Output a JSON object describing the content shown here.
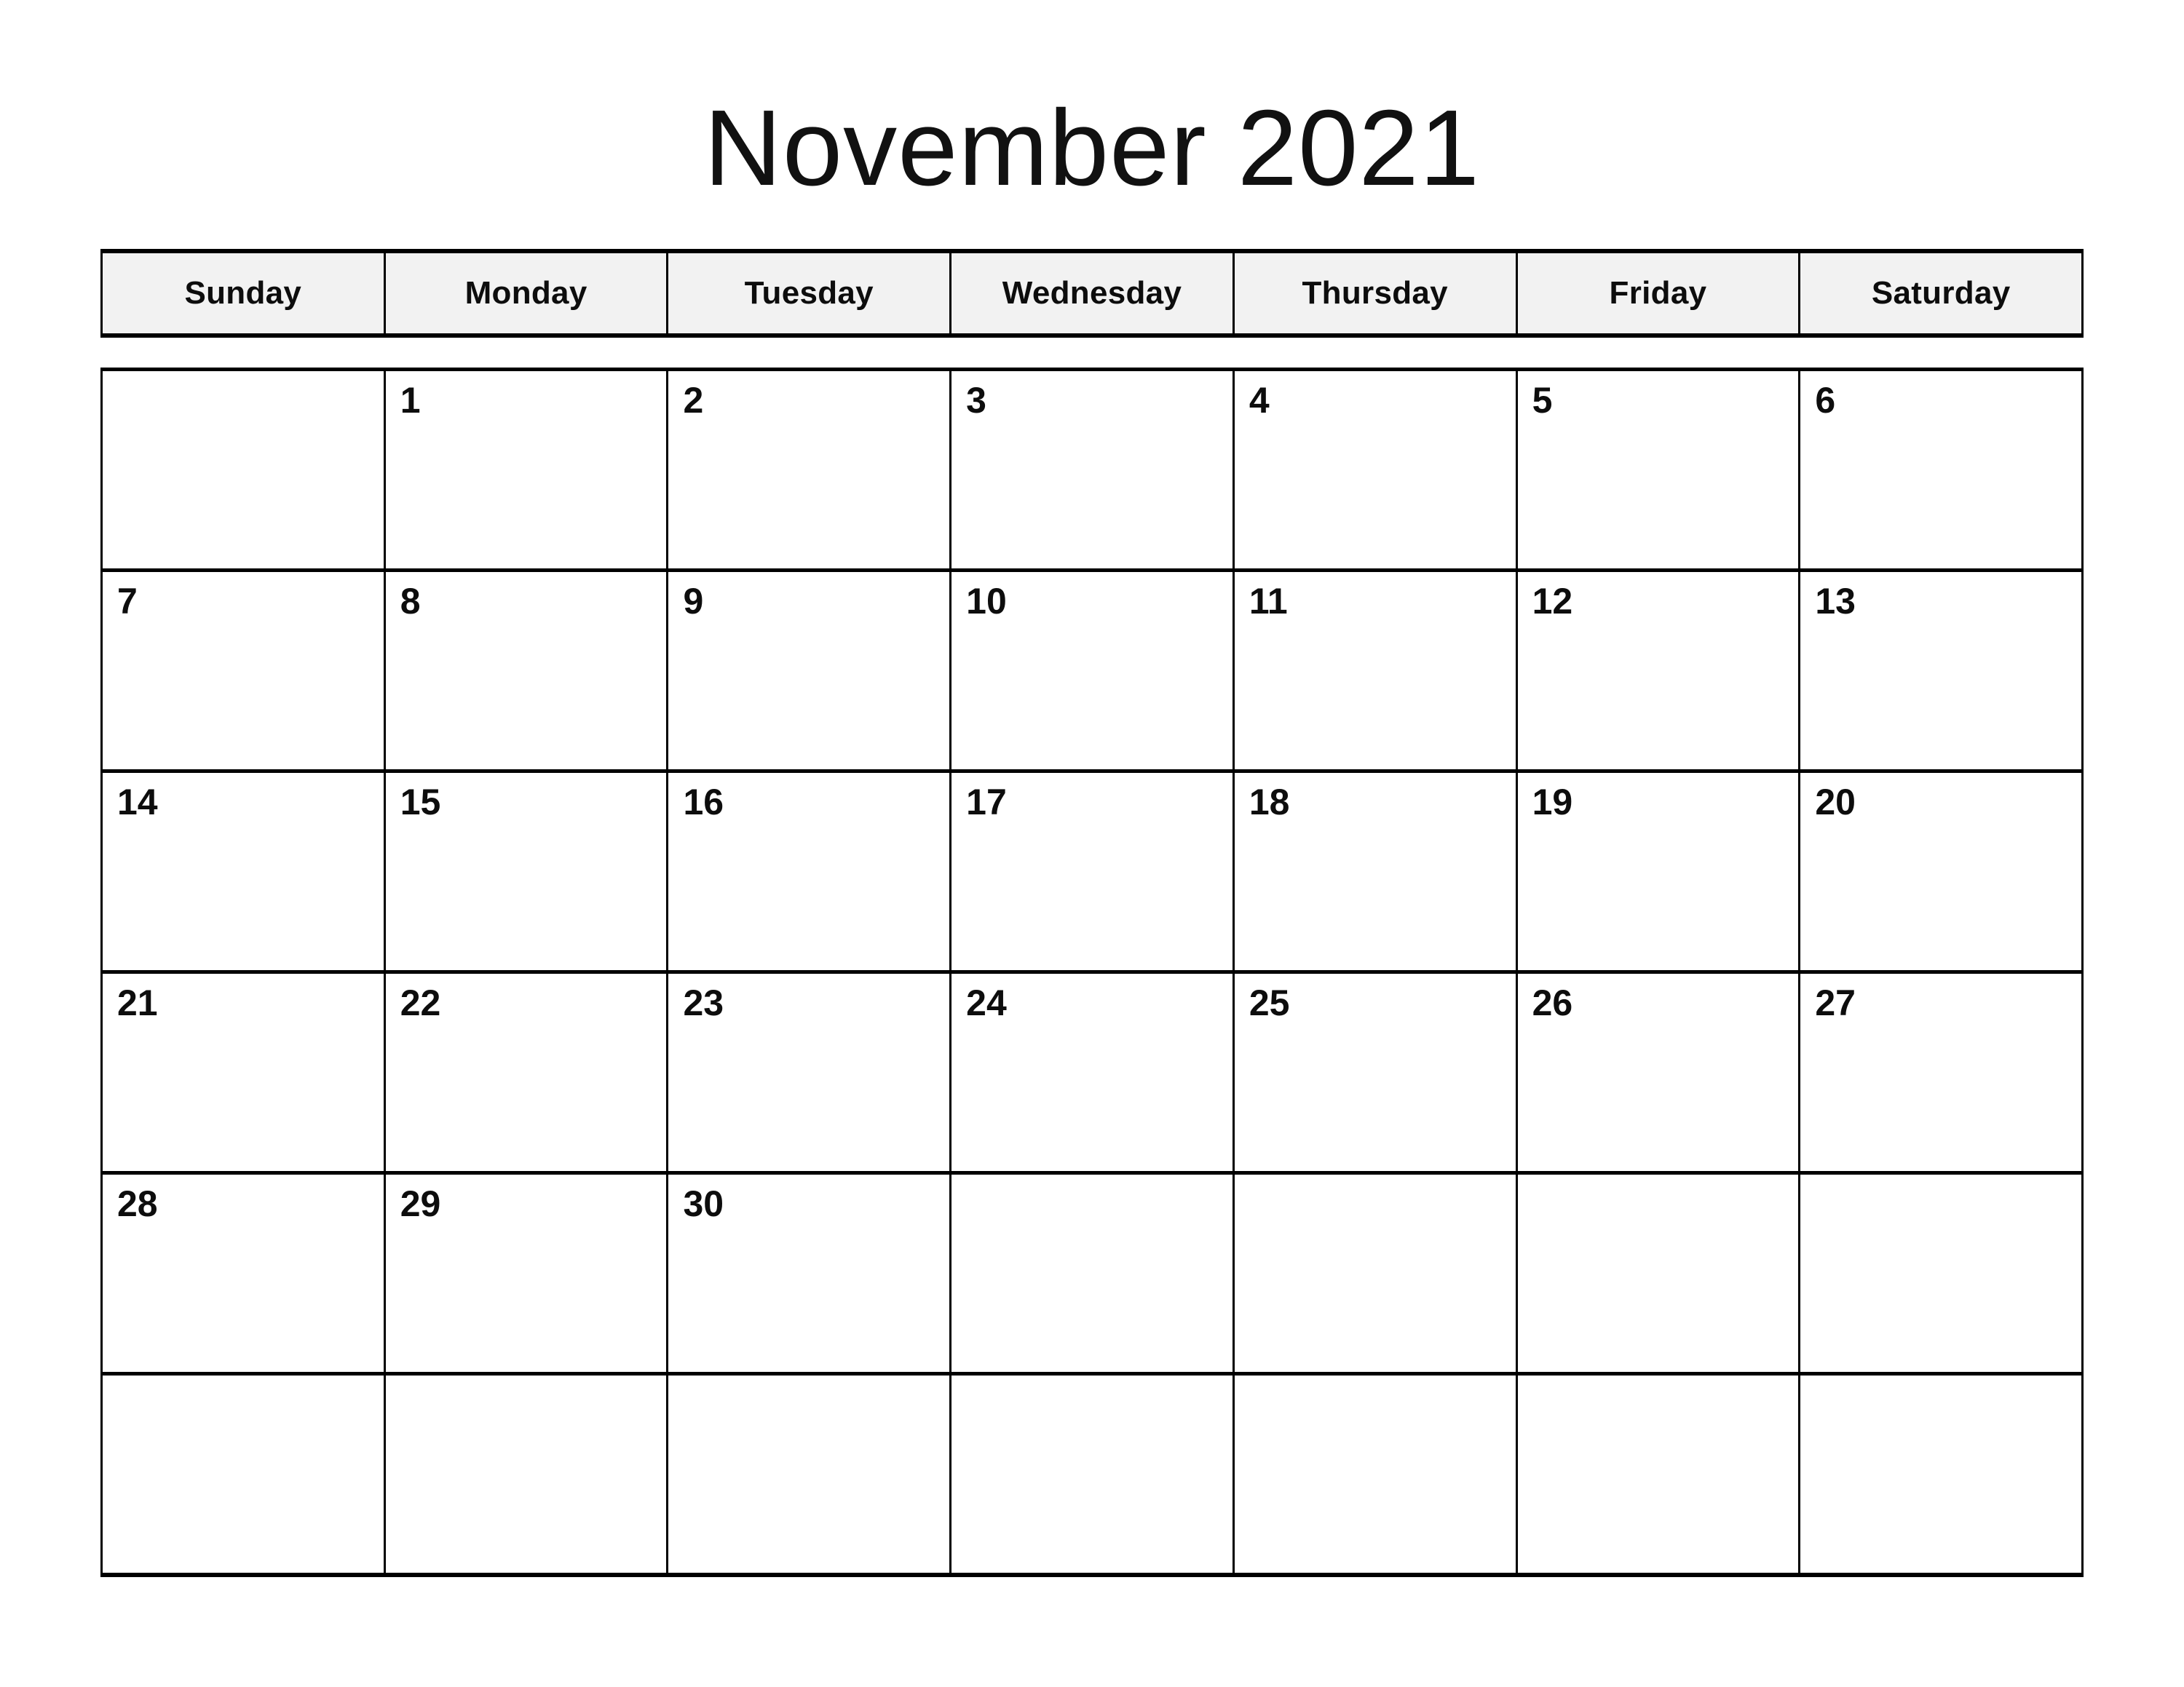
{
  "calendar": {
    "title": "November 2021",
    "month": "November",
    "year": "2021",
    "weekday_headers": [
      {
        "label": "Sunday"
      },
      {
        "label": "Monday"
      },
      {
        "label": "Tuesday"
      },
      {
        "label": "Wednesday"
      },
      {
        "label": "Thursday"
      },
      {
        "label": "Friday"
      },
      {
        "label": "Saturday"
      }
    ],
    "weeks": [
      {
        "days": [
          {
            "date": ""
          },
          {
            "date": "1"
          },
          {
            "date": "2"
          },
          {
            "date": "3"
          },
          {
            "date": "4"
          },
          {
            "date": "5"
          },
          {
            "date": "6"
          }
        ]
      },
      {
        "days": [
          {
            "date": "7"
          },
          {
            "date": "8"
          },
          {
            "date": "9"
          },
          {
            "date": "10"
          },
          {
            "date": "11"
          },
          {
            "date": "12"
          },
          {
            "date": "13"
          }
        ]
      },
      {
        "days": [
          {
            "date": "14"
          },
          {
            "date": "15"
          },
          {
            "date": "16"
          },
          {
            "date": "17"
          },
          {
            "date": "18"
          },
          {
            "date": "19"
          },
          {
            "date": "20"
          }
        ]
      },
      {
        "days": [
          {
            "date": "21"
          },
          {
            "date": "22"
          },
          {
            "date": "23"
          },
          {
            "date": "24"
          },
          {
            "date": "25"
          },
          {
            "date": "26"
          },
          {
            "date": "27"
          }
        ]
      },
      {
        "days": [
          {
            "date": "28"
          },
          {
            "date": "29"
          },
          {
            "date": "30"
          },
          {
            "date": ""
          },
          {
            "date": ""
          },
          {
            "date": ""
          },
          {
            "date": ""
          }
        ]
      },
      {
        "days": [
          {
            "date": ""
          },
          {
            "date": ""
          },
          {
            "date": ""
          },
          {
            "date": ""
          },
          {
            "date": ""
          },
          {
            "date": ""
          },
          {
            "date": ""
          }
        ]
      }
    ],
    "colors": {
      "page_background": "#ffffff",
      "header_background": "#f2f2f2",
      "border": "#000000",
      "text": "#0d0d0d",
      "title_text": "#111111"
    }
  }
}
